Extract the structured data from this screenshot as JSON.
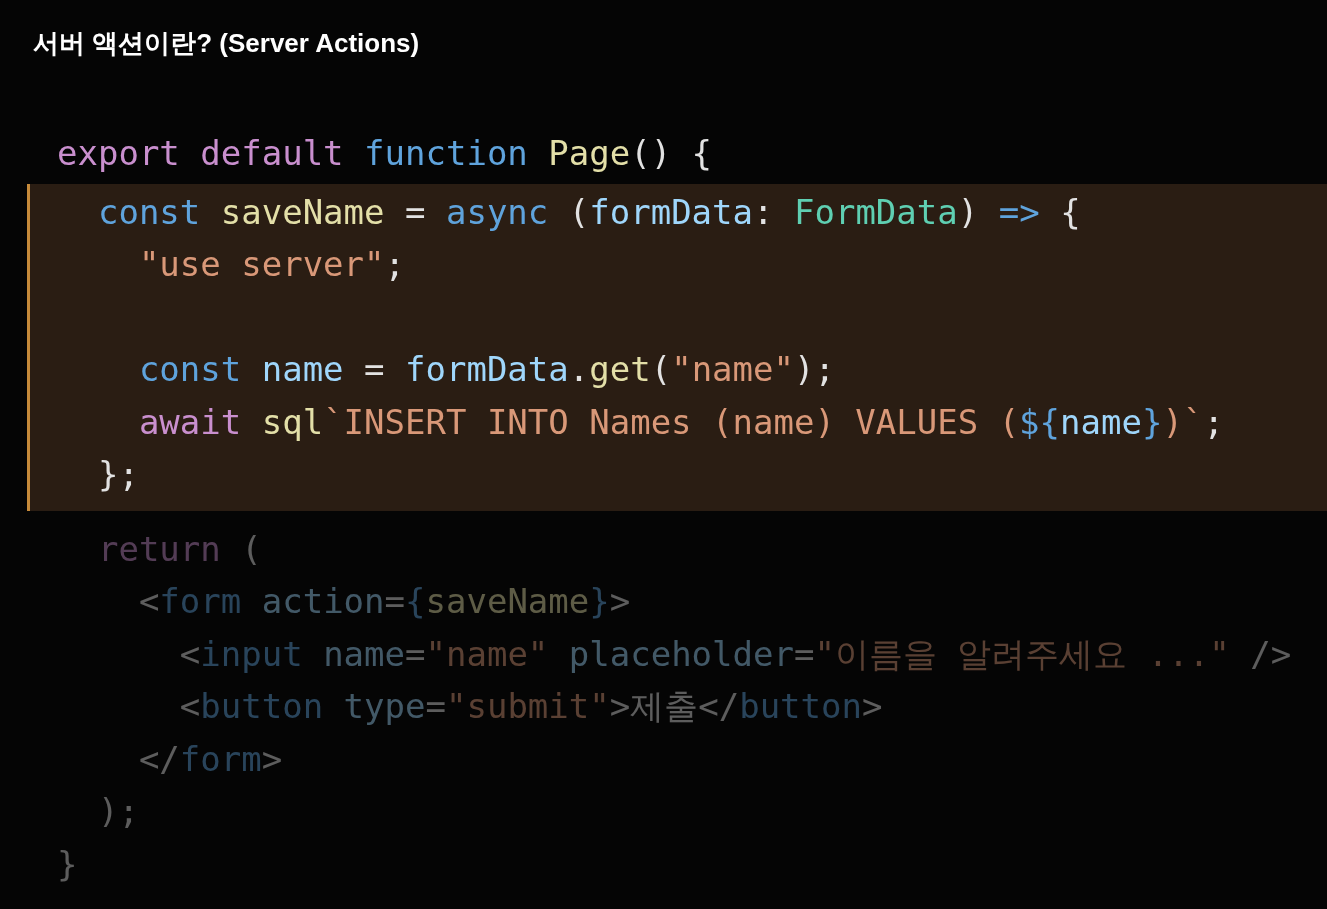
{
  "title": "서버 액션이란? (Server Actions)",
  "code_lines": [
    {
      "highlighted": false,
      "dimmed": false,
      "tokens": [
        {
          "kind": "keyword",
          "text": "export "
        },
        {
          "kind": "keyword",
          "text": "default "
        },
        {
          "kind": "storage",
          "text": "function "
        },
        {
          "kind": "function",
          "text": "Page"
        },
        {
          "kind": "plain",
          "text": "() {"
        }
      ]
    },
    {
      "highlighted": true,
      "dimmed": false,
      "tokens": [
        {
          "kind": "storage",
          "text": "  const "
        },
        {
          "kind": "function",
          "text": "saveName"
        },
        {
          "kind": "plain",
          "text": " = "
        },
        {
          "kind": "storage",
          "text": "async"
        },
        {
          "kind": "plain",
          "text": " ("
        },
        {
          "kind": "variable",
          "text": "formData"
        },
        {
          "kind": "plain",
          "text": ": "
        },
        {
          "kind": "type",
          "text": "FormData"
        },
        {
          "kind": "plain",
          "text": ") "
        },
        {
          "kind": "storage",
          "text": "=>"
        },
        {
          "kind": "plain",
          "text": " {"
        }
      ]
    },
    {
      "highlighted": true,
      "dimmed": false,
      "tokens": [
        {
          "kind": "string",
          "text": "    \"use server\""
        },
        {
          "kind": "plain",
          "text": ";"
        }
      ]
    },
    {
      "highlighted": true,
      "dimmed": false
    },
    {
      "highlighted": true,
      "dimmed": false,
      "tokens": [
        {
          "kind": "storage",
          "text": "    const "
        },
        {
          "kind": "variable",
          "text": "name"
        },
        {
          "kind": "plain",
          "text": " = "
        },
        {
          "kind": "variable",
          "text": "formData"
        },
        {
          "kind": "plain",
          "text": "."
        },
        {
          "kind": "function",
          "text": "get"
        },
        {
          "kind": "plain",
          "text": "("
        },
        {
          "kind": "string",
          "text": "\"name\""
        },
        {
          "kind": "plain",
          "text": ");"
        }
      ]
    },
    {
      "highlighted": true,
      "dimmed": false,
      "tokens": [
        {
          "kind": "keyword",
          "text": "    await "
        },
        {
          "kind": "function",
          "text": "sql"
        },
        {
          "kind": "string",
          "text": "`INSERT INTO Names (name) VALUES ("
        },
        {
          "kind": "storage",
          "text": "${"
        },
        {
          "kind": "variable",
          "text": "name"
        },
        {
          "kind": "storage",
          "text": "}"
        },
        {
          "kind": "string",
          "text": ")`"
        },
        {
          "kind": "plain",
          "text": ";"
        }
      ]
    },
    {
      "highlighted": true,
      "dimmed": false,
      "tokens": [
        {
          "kind": "plain",
          "text": "  };"
        }
      ]
    },
    {
      "highlighted": false,
      "dimmed": true,
      "tokens": [
        {
          "kind": "keyword",
          "text": "  return "
        },
        {
          "kind": "plain",
          "text": "("
        }
      ]
    },
    {
      "highlighted": false,
      "dimmed": true,
      "tokens": [
        {
          "kind": "plain",
          "text": "    <"
        },
        {
          "kind": "storage",
          "text": "form "
        },
        {
          "kind": "variable",
          "text": "action"
        },
        {
          "kind": "plain",
          "text": "="
        },
        {
          "kind": "storage",
          "text": "{"
        },
        {
          "kind": "function",
          "text": "saveName"
        },
        {
          "kind": "storage",
          "text": "}"
        },
        {
          "kind": "plain",
          "text": ">"
        }
      ]
    },
    {
      "highlighted": false,
      "dimmed": true,
      "tokens": [
        {
          "kind": "plain",
          "text": "      <"
        },
        {
          "kind": "storage",
          "text": "input "
        },
        {
          "kind": "variable",
          "text": "name"
        },
        {
          "kind": "plain",
          "text": "="
        },
        {
          "kind": "string",
          "text": "\"name\" "
        },
        {
          "kind": "variable",
          "text": "placeholder"
        },
        {
          "kind": "plain",
          "text": "="
        },
        {
          "kind": "string",
          "text": "\"이름을 알려주세요 ...\""
        },
        {
          "kind": "plain",
          "text": " />"
        }
      ]
    },
    {
      "highlighted": false,
      "dimmed": true,
      "tokens": [
        {
          "kind": "plain",
          "text": "      <"
        },
        {
          "kind": "storage",
          "text": "button "
        },
        {
          "kind": "variable",
          "text": "type"
        },
        {
          "kind": "plain",
          "text": "="
        },
        {
          "kind": "string",
          "text": "\"submit\""
        },
        {
          "kind": "plain",
          "text": ">제출</"
        },
        {
          "kind": "storage",
          "text": "button"
        },
        {
          "kind": "plain",
          "text": ">"
        }
      ]
    },
    {
      "highlighted": false,
      "dimmed": true,
      "tokens": [
        {
          "kind": "plain",
          "text": "    </"
        },
        {
          "kind": "storage",
          "text": "form"
        },
        {
          "kind": "plain",
          "text": ">"
        }
      ]
    },
    {
      "highlighted": false,
      "dimmed": true,
      "tokens": [
        {
          "kind": "plain",
          "text": "  );"
        }
      ]
    },
    {
      "highlighted": false,
      "dimmed": true,
      "tokens": [
        {
          "kind": "plain",
          "text": "}"
        }
      ]
    }
  ]
}
